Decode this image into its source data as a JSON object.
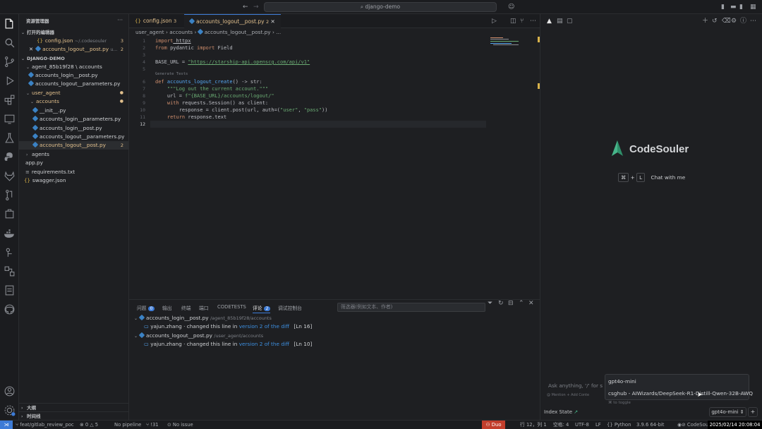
{
  "titlebar": {
    "search": "django-demo"
  },
  "sidebar": {
    "title": "资源管理器",
    "open_editors_header": "打开的编辑器",
    "open_editors": [
      {
        "name": "config.json",
        "path": "~/.codesouler",
        "badge": "3"
      },
      {
        "name": "accounts_logout__post.py",
        "path": "u...",
        "badge": "2"
      }
    ],
    "project_header": "DJANGO-DEMO",
    "tree": [
      {
        "label": "agent_85b19f28 \\ accounts",
        "kind": "folder"
      },
      {
        "label": "accounts_login__post.py",
        "kind": "py"
      },
      {
        "label": "accounts_logout__parameters.py",
        "kind": "py"
      },
      {
        "label": "user_agent",
        "kind": "folder-mod"
      },
      {
        "label": "accounts",
        "kind": "folder-mod"
      },
      {
        "label": "__init__.py",
        "kind": "py"
      },
      {
        "label": "accounts_login__parameters.py",
        "kind": "py"
      },
      {
        "label": "accounts_login__post.py",
        "kind": "py"
      },
      {
        "label": "accounts_logout__parameters.py",
        "kind": "py"
      },
      {
        "label": "accounts_logout__post.py",
        "kind": "py-mod",
        "badge": "2"
      },
      {
        "label": "agents",
        "kind": "folder-closed"
      },
      {
        "label": "app.py",
        "kind": "py"
      },
      {
        "label": "requirements.txt",
        "kind": "txt"
      },
      {
        "label": "swagger.json",
        "kind": "json"
      }
    ],
    "outline": "大纲",
    "timeline": "时间线"
  },
  "tabs": [
    {
      "label": "config.json",
      "badge": "3"
    },
    {
      "label": "accounts_logout__post.py",
      "badge": "2"
    }
  ],
  "breadcrumb": [
    "user_agent",
    "accounts",
    "accounts_logout__post.py",
    "..."
  ],
  "code": {
    "lines": [
      "1",
      "2",
      "3",
      "4",
      "5",
      "6",
      "7",
      "8",
      "9",
      "10",
      "11",
      "12"
    ],
    "l1_kw": "import",
    "l1_rest": " httpx",
    "l2_kw1": "from",
    "l2_mid": " pydantic ",
    "l2_kw2": "import",
    "l2_rest": " Field",
    "l4_a": "BASE_URL = ",
    "l4_str": "\"https://starship-api.openscg.com/api/v1\"",
    "codelens": "Generate Tests",
    "l6_kw": "def",
    "l6_fn": " accounts_logout_create",
    "l6_rest": "() -> str:",
    "l7": "    \"\"\"Log out the current account.\"\"\"",
    "l8_a": "    url = ",
    "l8_str": "f\"{BASE_URL}/accounts/logout/\"",
    "l9_kw": "    with",
    "l9_rest": " requests.Session() as client:",
    "l10_a": "        response = client.post(url, auth=(",
    "l10_s1": "\"user\"",
    "l10_b": ", ",
    "l10_s2": "\"pass\"",
    "l10_c": "))",
    "l11_kw": "    return",
    "l11_rest": " response.text"
  },
  "panel": {
    "tabs": [
      "问题",
      "输出",
      "终端",
      "端口",
      "CODETESTS",
      "评论",
      "调试控制台"
    ],
    "problems_badge": "0",
    "comments_badge": "2",
    "filter_placeholder": "筛选器(例如文本、作者)",
    "comments": [
      {
        "file": "accounts_login__post.py",
        "path": "/agent_85b19f28/accounts",
        "author": "yajun.zhang",
        "text": "changed this line in",
        "link": "version 2 of the diff",
        "line": "[Ln 16]"
      },
      {
        "file": "accounts_logout__post.py",
        "path": "/user_agent/accounts",
        "author": "yajun.zhang",
        "text": "changed this line in",
        "link": "version 2 of the diff",
        "line": "[Ln 10]"
      }
    ]
  },
  "chat": {
    "brand": "CodeSouler",
    "shortcut_key1": "⌘",
    "shortcut_plus": "+",
    "shortcut_key2": "L",
    "shortcut_label": "Chat with me",
    "input_placeholder": "Ask anything, '/' for s",
    "hint_mention": "@ Mention",
    "hint_add": "+ Add Conte",
    "hint_toggle": "⌘ to toggle",
    "models": [
      "gpt4o-mini",
      "csghub - AIWizards/DeepSeek-R1-Distill-Qwen-32B-AWQ"
    ],
    "index_state": "Index State",
    "selected_model": "gpt4o-mini"
  },
  "statusbar": {
    "branch": "feat/gitlab_review_poc",
    "errors": "0",
    "warnings": "5",
    "pipeline": "No pipeline",
    "mr": "!31",
    "issue": "No issue",
    "duo": "Duo",
    "position": "行 12，列 1",
    "spaces": "空格: 4",
    "encoding": "UTF-8",
    "eol": "LF",
    "language": "Python",
    "python_version": "3.9.6 64-bit",
    "codesouler": "CodeSou",
    "datetime": "2025/02/14 20:08:04"
  }
}
